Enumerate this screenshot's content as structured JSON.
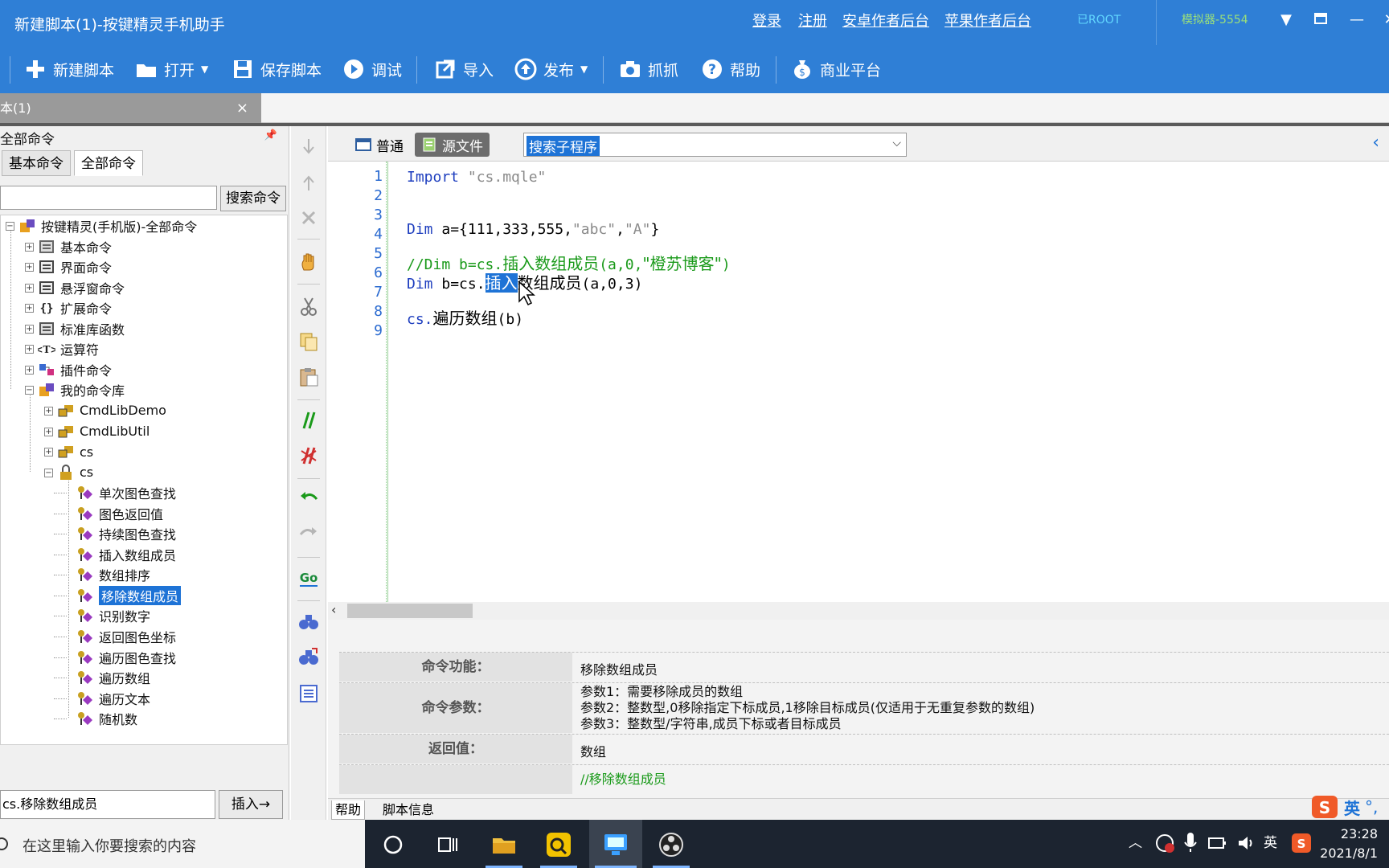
{
  "window": {
    "title": "新建脚本(1)-按键精灵手机助手",
    "links": [
      "登录",
      "注册",
      "安卓作者后台",
      "苹果作者后台"
    ],
    "root_status": "已ROOT",
    "emulator": "模拟器-5554"
  },
  "toolbar": {
    "new_script": "新建脚本",
    "open": "打开",
    "save_script": "保存脚本",
    "debug": "调试",
    "import": "导入",
    "publish": "发布",
    "capture": "抓抓",
    "help": "帮助",
    "business": "商业平台"
  },
  "doc_tab": {
    "label": "本(1)",
    "close": "×"
  },
  "left_panel": {
    "header": "全部命令",
    "pin": "ᵖ",
    "tabs": [
      "基本命令",
      "全部命令"
    ],
    "search_button": "搜索命令",
    "tree": [
      {
        "label": "按键精灵(手机版)-全部命令",
        "level": 0,
        "expander": "−",
        "icon": "package-icon"
      },
      {
        "label": "基本命令",
        "level": 1,
        "expander": "+",
        "icon": "gear-icon"
      },
      {
        "label": "界面命令",
        "level": 1,
        "expander": "+",
        "icon": "window-icon"
      },
      {
        "label": "悬浮窗命令",
        "level": 1,
        "expander": "+",
        "icon": "window-icon"
      },
      {
        "label": "扩展命令",
        "level": 1,
        "expander": "+",
        "icon": "braces-icon"
      },
      {
        "label": "标准库函数",
        "level": 1,
        "expander": "+",
        "icon": "function-icon"
      },
      {
        "label": "运算符",
        "level": 1,
        "expander": "+",
        "icon": "operator-icon"
      },
      {
        "label": "插件命令",
        "level": 1,
        "expander": "+",
        "icon": "plugin-icon"
      },
      {
        "label": "我的命令库",
        "level": 1,
        "expander": "−",
        "icon": "package-icon"
      },
      {
        "label": "CmdLibDemo",
        "level": 2,
        "expander": "+",
        "icon": "key-icon"
      },
      {
        "label": "CmdLibUtil",
        "level": 2,
        "expander": "+",
        "icon": "key-icon"
      },
      {
        "label": "cs",
        "level": 2,
        "expander": "+",
        "icon": "key-icon"
      },
      {
        "label": "cs",
        "level": 2,
        "expander": "−",
        "icon": "lock-icon"
      },
      {
        "label": "单次图色查找",
        "level": 3,
        "expander": "",
        "icon": "method-icon"
      },
      {
        "label": "图色返回值",
        "level": 3,
        "expander": "",
        "icon": "method-icon"
      },
      {
        "label": "持续图色查找",
        "level": 3,
        "expander": "",
        "icon": "method-icon"
      },
      {
        "label": "插入数组成员",
        "level": 3,
        "expander": "",
        "icon": "method-icon"
      },
      {
        "label": "数组排序",
        "level": 3,
        "expander": "",
        "icon": "method-icon"
      },
      {
        "label": "移除数组成员",
        "level": 3,
        "expander": "",
        "icon": "method-icon",
        "selected": true
      },
      {
        "label": "识别数字",
        "level": 3,
        "expander": "",
        "icon": "method-icon"
      },
      {
        "label": "返回图色坐标",
        "level": 3,
        "expander": "",
        "icon": "method-icon"
      },
      {
        "label": "遍历图色查找",
        "level": 3,
        "expander": "",
        "icon": "method-icon"
      },
      {
        "label": "遍历数组",
        "level": 3,
        "expander": "",
        "icon": "method-icon"
      },
      {
        "label": "遍历文本",
        "level": 3,
        "expander": "",
        "icon": "method-icon"
      },
      {
        "label": "随机数",
        "level": 3,
        "expander": "",
        "icon": "method-icon"
      }
    ],
    "bottom_input": "cs.移除数组成员",
    "insert_button": "插入→"
  },
  "editor_bar": {
    "mode_normal": "普通",
    "mode_source": "源文件",
    "sub_search": "搜索子程序"
  },
  "code": {
    "line_numbers": [
      "1",
      "2",
      "3",
      "4",
      "5",
      "6",
      "7",
      "8",
      "9"
    ],
    "l1_kw": "Import ",
    "l1_str": "\"cs.mqle\"",
    "l4_kw": "Dim ",
    "l4_a": "a={111,333,555,",
    "l4_s1": "\"abc\"",
    "l4_c": ",",
    "l4_s2": "\"A\"",
    "l4_end": "}",
    "l6_a": "//Dim b=cs.",
    "l6_b": "插入数组成员",
    "l6_c": "(a,0,",
    "l6_d": "\"橙苏博客\"",
    "l6_e": ")",
    "l7_kw": "Dim ",
    "l7_a": "b=cs.",
    "l7_sel": "插入",
    "l7_b": "数组成员",
    "l7_c": "(a,0,3)",
    "l9_a": "cs.",
    "l9_b": "遍历数组",
    "l9_c": "(b)"
  },
  "help": {
    "func_key": "命令功能：",
    "func_val": "移除数组成员",
    "param_key": "命令参数：",
    "param_lines": [
      "参数1：需要移除成员的数组",
      "参数2：整数型,0移除指定下标成员,1移除目标成员(仅适用于无重复参数的数组)",
      "参数3：整数型/字符串,成员下标或者目标成员"
    ],
    "ret_key": "返回值：",
    "ret_val": "数组",
    "example": "//移除数组成员",
    "tabs": [
      "帮助",
      "脚本信息"
    ]
  },
  "ime": {
    "label": "英"
  },
  "taskbar": {
    "search_placeholder": "在这里输入你要搜索的内容",
    "tray_lang": "英",
    "time": "23:28",
    "date": "2021/8/1"
  },
  "colors": {
    "accent": "#2f7fd6",
    "selection": "#1e73d6",
    "keyword": "#1f3fbf",
    "comment": "#1a9a1a"
  }
}
